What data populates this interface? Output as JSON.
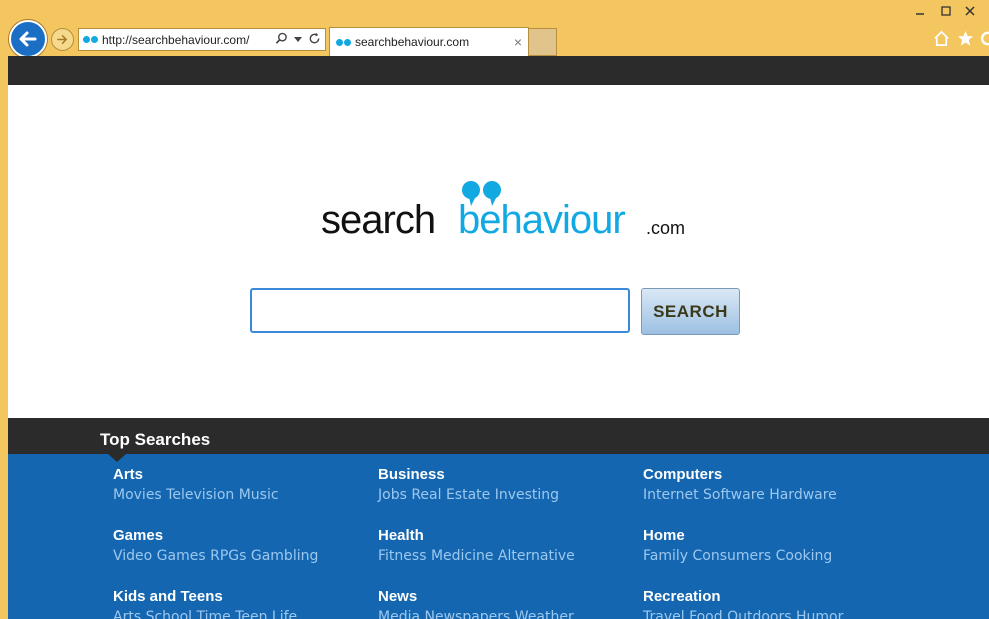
{
  "browser": {
    "address_url": "http://searchbehaviour.com/",
    "tab_title": "searchbehaviour.com",
    "tab_close": "×"
  },
  "logo": {
    "part1": "search",
    "part2": "behaviour",
    "part3": ".com"
  },
  "search": {
    "placeholder": "",
    "value": "",
    "button_label": "SEARCH"
  },
  "top_searches": {
    "title": "Top Searches",
    "categories": [
      {
        "title": "Arts",
        "links": "Movies Television Music"
      },
      {
        "title": "Business",
        "links": "Jobs Real Estate Investing"
      },
      {
        "title": "Computers",
        "links": "Internet Software Hardware"
      },
      {
        "title": "Games",
        "links": "Video Games RPGs Gambling"
      },
      {
        "title": "Health",
        "links": "Fitness Medicine Alternative"
      },
      {
        "title": "Home",
        "links": "Family Consumers Cooking"
      },
      {
        "title": "Kids and Teens",
        "links": "Arts School Time Teen Life"
      },
      {
        "title": "News",
        "links": "Media Newspapers Weather"
      },
      {
        "title": "Recreation",
        "links": "Travel Food Outdoors Humor"
      }
    ]
  },
  "colors": {
    "chrome": "#f3c65f",
    "brand_blue": "#12a9e3",
    "category_bg": "#1566b0",
    "dark_bar": "#2b2b2b"
  }
}
